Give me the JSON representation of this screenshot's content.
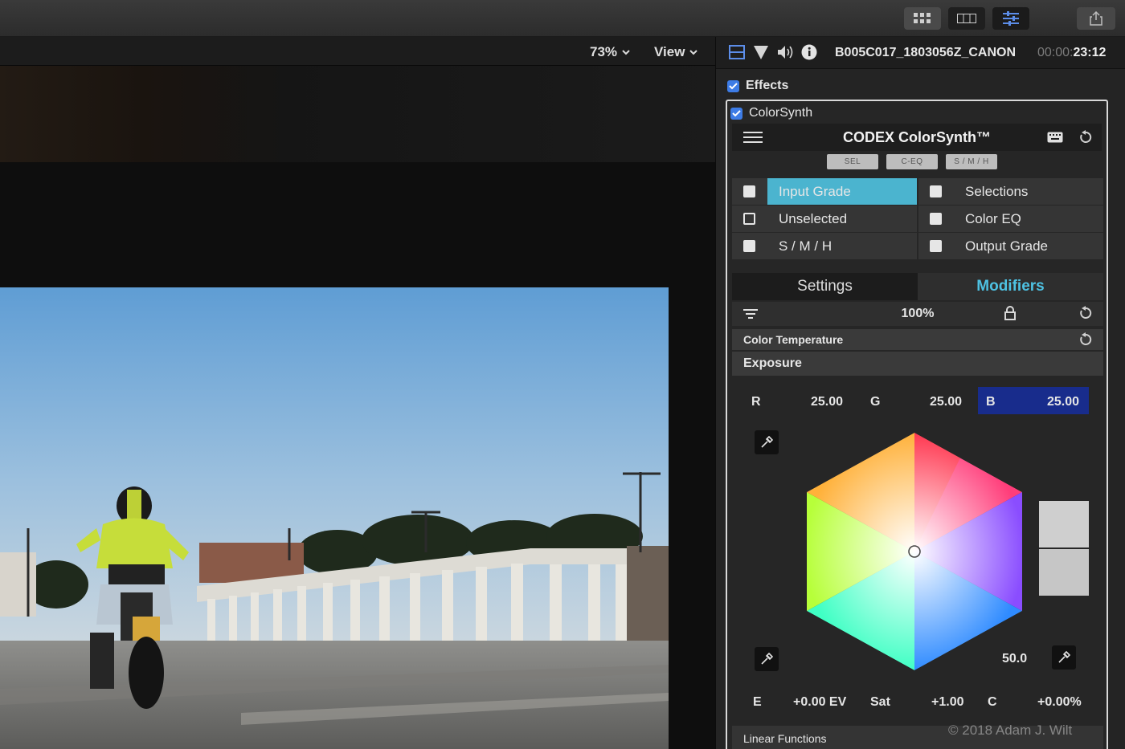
{
  "toolbar": {
    "buttons": [
      "grid-view-icon",
      "filmstrip-icon",
      "inspector-icon",
      "share-icon"
    ]
  },
  "viewer": {
    "zoom": "73%",
    "view_menu": "View"
  },
  "inspector": {
    "clip_name": "B005C017_1803056Z_CANON",
    "timecode_dim": "00:00:",
    "timecode_bright": "23:12",
    "effects_label": "Effects",
    "effect_name": "ColorSynth"
  },
  "colorsynth": {
    "title": "CODEX ColorSynth™",
    "modes": [
      "SEL",
      "C-EQ",
      "S / M / H"
    ],
    "grid": [
      {
        "label": "Input Grade",
        "highlighted": true
      },
      {
        "label": "Selections",
        "highlighted": false
      },
      {
        "label": "Unselected",
        "highlighted": false
      },
      {
        "label": "Color EQ",
        "highlighted": false
      },
      {
        "label": "S / M / H",
        "highlighted": false
      },
      {
        "label": "Output Grade",
        "highlighted": false
      }
    ],
    "tabs": {
      "settings": "Settings",
      "modifiers": "Modifiers"
    },
    "amount": "100%",
    "color_temperature": "Color Temperature",
    "exposure_label": "Exposure",
    "rgb": {
      "r_label": "R",
      "r_value": "25.00",
      "g_label": "G",
      "g_value": "25.00",
      "b_label": "B",
      "b_value": "25.00"
    },
    "wheel_value": "50.0",
    "exposure": {
      "e_label": "E",
      "e_value": "+0.00 EV",
      "sat_label": "Sat",
      "sat_value": "+1.00",
      "c_label": "C",
      "c_value": "+0.00%"
    },
    "linear_functions": "Linear Functions"
  },
  "watermark": "© 2018 Adam J. Wilt"
}
